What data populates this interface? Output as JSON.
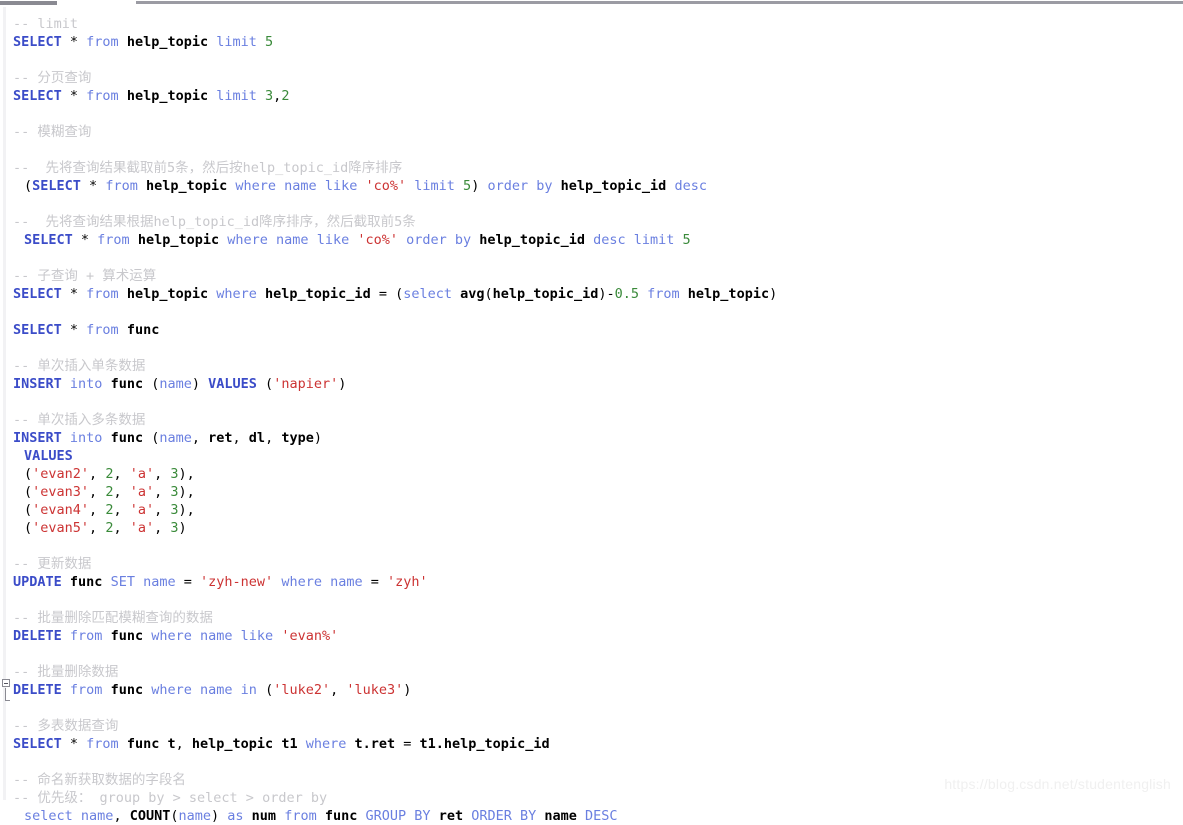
{
  "watermark": "https://blog.csdn.net/studentenglish",
  "colors": {
    "background": "#ffffff",
    "keyword_major": "#3b4cc8",
    "keyword_minor": "#6a7fe0",
    "identifier": "#000000",
    "number": "#3a8a3a",
    "string": "#cc3333",
    "comment": "#c8c8cc",
    "scrollbar": "#8a8a92",
    "watermark": "#f0f0f0"
  },
  "scrollbar": {
    "name": "horizontal-scrollbar",
    "thumb_label": "scroll-thumb",
    "track_label": "scroll-track"
  },
  "fold": {
    "name": "code-fold-collapse",
    "state": "expanded",
    "glyph": "-"
  },
  "lines": [
    {
      "indent": 0,
      "tokens": [
        {
          "t": "cmt",
          "v": "-- limit"
        }
      ]
    },
    {
      "indent": 0,
      "tokens": [
        {
          "t": "kw",
          "v": "SELECT"
        },
        {
          "t": "op",
          "v": " * "
        },
        {
          "t": "kw2",
          "v": "from"
        },
        {
          "t": "op",
          "v": " "
        },
        {
          "t": "ident",
          "v": "help_topic"
        },
        {
          "t": "op",
          "v": " "
        },
        {
          "t": "kw2",
          "v": "limit"
        },
        {
          "t": "op",
          "v": " "
        },
        {
          "t": "num",
          "v": "5"
        }
      ]
    },
    {
      "indent": 0,
      "tokens": []
    },
    {
      "indent": 0,
      "tokens": [
        {
          "t": "cmt",
          "v": "-- 分页查询"
        }
      ]
    },
    {
      "indent": 0,
      "tokens": [
        {
          "t": "kw",
          "v": "SELECT"
        },
        {
          "t": "op",
          "v": " * "
        },
        {
          "t": "kw2",
          "v": "from"
        },
        {
          "t": "op",
          "v": " "
        },
        {
          "t": "ident",
          "v": "help_topic"
        },
        {
          "t": "op",
          "v": " "
        },
        {
          "t": "kw2",
          "v": "limit"
        },
        {
          "t": "op",
          "v": " "
        },
        {
          "t": "num",
          "v": "3"
        },
        {
          "t": "op",
          "v": ","
        },
        {
          "t": "num",
          "v": "2"
        }
      ]
    },
    {
      "indent": 0,
      "tokens": []
    },
    {
      "indent": 0,
      "tokens": [
        {
          "t": "cmt",
          "v": "-- 模糊查询"
        }
      ]
    },
    {
      "indent": 0,
      "tokens": []
    },
    {
      "indent": 0,
      "tokens": [
        {
          "t": "cmt",
          "v": "--  先将查询结果截取前5条，然后按help_topic_id降序排序"
        }
      ]
    },
    {
      "indent": 1,
      "tokens": [
        {
          "t": "op",
          "v": "("
        },
        {
          "t": "kw",
          "v": "SELECT"
        },
        {
          "t": "op",
          "v": " * "
        },
        {
          "t": "kw2",
          "v": "from"
        },
        {
          "t": "op",
          "v": " "
        },
        {
          "t": "ident",
          "v": "help_topic"
        },
        {
          "t": "op",
          "v": " "
        },
        {
          "t": "kw2",
          "v": "where"
        },
        {
          "t": "op",
          "v": " "
        },
        {
          "t": "kw2",
          "v": "name"
        },
        {
          "t": "op",
          "v": " "
        },
        {
          "t": "kw2",
          "v": "like"
        },
        {
          "t": "op",
          "v": " "
        },
        {
          "t": "str",
          "v": "'co%'"
        },
        {
          "t": "op",
          "v": " "
        },
        {
          "t": "kw2",
          "v": "limit"
        },
        {
          "t": "op",
          "v": " "
        },
        {
          "t": "num",
          "v": "5"
        },
        {
          "t": "op",
          "v": ") "
        },
        {
          "t": "kw2",
          "v": "order by"
        },
        {
          "t": "op",
          "v": " "
        },
        {
          "t": "ident",
          "v": "help_topic_id"
        },
        {
          "t": "op",
          "v": " "
        },
        {
          "t": "kw2",
          "v": "desc"
        }
      ]
    },
    {
      "indent": 0,
      "tokens": []
    },
    {
      "indent": 0,
      "tokens": [
        {
          "t": "cmt",
          "v": "--  先将查询结果根据help_topic_id降序排序，然后截取前5条"
        }
      ]
    },
    {
      "indent": 1,
      "tokens": [
        {
          "t": "kw",
          "v": "SELECT"
        },
        {
          "t": "op",
          "v": " * "
        },
        {
          "t": "kw2",
          "v": "from"
        },
        {
          "t": "op",
          "v": " "
        },
        {
          "t": "ident",
          "v": "help_topic"
        },
        {
          "t": "op",
          "v": " "
        },
        {
          "t": "kw2",
          "v": "where"
        },
        {
          "t": "op",
          "v": " "
        },
        {
          "t": "kw2",
          "v": "name"
        },
        {
          "t": "op",
          "v": " "
        },
        {
          "t": "kw2",
          "v": "like"
        },
        {
          "t": "op",
          "v": " "
        },
        {
          "t": "str",
          "v": "'co%'"
        },
        {
          "t": "op",
          "v": " "
        },
        {
          "t": "kw2",
          "v": "order by"
        },
        {
          "t": "op",
          "v": " "
        },
        {
          "t": "ident",
          "v": "help_topic_id"
        },
        {
          "t": "op",
          "v": " "
        },
        {
          "t": "kw2",
          "v": "desc"
        },
        {
          "t": "op",
          "v": " "
        },
        {
          "t": "kw2",
          "v": "limit"
        },
        {
          "t": "op",
          "v": " "
        },
        {
          "t": "num",
          "v": "5"
        }
      ]
    },
    {
      "indent": 0,
      "tokens": []
    },
    {
      "indent": 0,
      "tokens": [
        {
          "t": "cmt",
          "v": "-- 子查询 + 算术运算"
        }
      ]
    },
    {
      "indent": 0,
      "tokens": [
        {
          "t": "kw",
          "v": "SELECT"
        },
        {
          "t": "op",
          "v": " * "
        },
        {
          "t": "kw2",
          "v": "from"
        },
        {
          "t": "op",
          "v": " "
        },
        {
          "t": "ident",
          "v": "help_topic"
        },
        {
          "t": "op",
          "v": " "
        },
        {
          "t": "kw2",
          "v": "where"
        },
        {
          "t": "op",
          "v": " "
        },
        {
          "t": "ident",
          "v": "help_topic_id"
        },
        {
          "t": "op",
          "v": " = ("
        },
        {
          "t": "kw2",
          "v": "select"
        },
        {
          "t": "op",
          "v": " "
        },
        {
          "t": "fn",
          "v": "avg"
        },
        {
          "t": "op",
          "v": "("
        },
        {
          "t": "ident",
          "v": "help_topic_id"
        },
        {
          "t": "op",
          "v": ")-"
        },
        {
          "t": "num",
          "v": "0.5"
        },
        {
          "t": "op",
          "v": " "
        },
        {
          "t": "kw2",
          "v": "from"
        },
        {
          "t": "op",
          "v": " "
        },
        {
          "t": "ident",
          "v": "help_topic"
        },
        {
          "t": "op",
          "v": ")"
        }
      ]
    },
    {
      "indent": 0,
      "tokens": []
    },
    {
      "indent": 0,
      "tokens": [
        {
          "t": "kw",
          "v": "SELECT"
        },
        {
          "t": "op",
          "v": " * "
        },
        {
          "t": "kw2",
          "v": "from"
        },
        {
          "t": "op",
          "v": " "
        },
        {
          "t": "ident",
          "v": "func"
        }
      ]
    },
    {
      "indent": 0,
      "tokens": []
    },
    {
      "indent": 0,
      "tokens": [
        {
          "t": "cmt",
          "v": "-- 单次插入单条数据"
        }
      ]
    },
    {
      "indent": 0,
      "tokens": [
        {
          "t": "kw",
          "v": "INSERT"
        },
        {
          "t": "op",
          "v": " "
        },
        {
          "t": "kw2",
          "v": "into"
        },
        {
          "t": "op",
          "v": " "
        },
        {
          "t": "ident",
          "v": "func"
        },
        {
          "t": "op",
          "v": " ("
        },
        {
          "t": "kw2",
          "v": "name"
        },
        {
          "t": "op",
          "v": ") "
        },
        {
          "t": "kw",
          "v": "VALUES"
        },
        {
          "t": "op",
          "v": " ("
        },
        {
          "t": "str",
          "v": "'napier'"
        },
        {
          "t": "op",
          "v": ")"
        }
      ]
    },
    {
      "indent": 0,
      "tokens": []
    },
    {
      "indent": 0,
      "tokens": [
        {
          "t": "cmt",
          "v": "-- 单次插入多条数据"
        }
      ]
    },
    {
      "indent": 0,
      "tokens": [
        {
          "t": "kw",
          "v": "INSERT"
        },
        {
          "t": "op",
          "v": " "
        },
        {
          "t": "kw2",
          "v": "into"
        },
        {
          "t": "op",
          "v": " "
        },
        {
          "t": "ident",
          "v": "func"
        },
        {
          "t": "op",
          "v": " ("
        },
        {
          "t": "kw2",
          "v": "name"
        },
        {
          "t": "op",
          "v": ", "
        },
        {
          "t": "ident",
          "v": "ret"
        },
        {
          "t": "op",
          "v": ", "
        },
        {
          "t": "ident",
          "v": "dl"
        },
        {
          "t": "op",
          "v": ", "
        },
        {
          "t": "ident",
          "v": "type"
        },
        {
          "t": "op",
          "v": ")"
        }
      ]
    },
    {
      "indent": 1,
      "tokens": [
        {
          "t": "kw",
          "v": "VALUES"
        }
      ]
    },
    {
      "indent": 1,
      "tokens": [
        {
          "t": "op",
          "v": "("
        },
        {
          "t": "str",
          "v": "'evan2'"
        },
        {
          "t": "op",
          "v": ", "
        },
        {
          "t": "num",
          "v": "2"
        },
        {
          "t": "op",
          "v": ", "
        },
        {
          "t": "str",
          "v": "'a'"
        },
        {
          "t": "op",
          "v": ", "
        },
        {
          "t": "num",
          "v": "3"
        },
        {
          "t": "op",
          "v": "),"
        }
      ]
    },
    {
      "indent": 1,
      "tokens": [
        {
          "t": "op",
          "v": "("
        },
        {
          "t": "str",
          "v": "'evan3'"
        },
        {
          "t": "op",
          "v": ", "
        },
        {
          "t": "num",
          "v": "2"
        },
        {
          "t": "op",
          "v": ", "
        },
        {
          "t": "str",
          "v": "'a'"
        },
        {
          "t": "op",
          "v": ", "
        },
        {
          "t": "num",
          "v": "3"
        },
        {
          "t": "op",
          "v": "),"
        }
      ]
    },
    {
      "indent": 1,
      "tokens": [
        {
          "t": "op",
          "v": "("
        },
        {
          "t": "str",
          "v": "'evan4'"
        },
        {
          "t": "op",
          "v": ", "
        },
        {
          "t": "num",
          "v": "2"
        },
        {
          "t": "op",
          "v": ", "
        },
        {
          "t": "str",
          "v": "'a'"
        },
        {
          "t": "op",
          "v": ", "
        },
        {
          "t": "num",
          "v": "3"
        },
        {
          "t": "op",
          "v": "),"
        }
      ]
    },
    {
      "indent": 1,
      "tokens": [
        {
          "t": "op",
          "v": "("
        },
        {
          "t": "str",
          "v": "'evan5'"
        },
        {
          "t": "op",
          "v": ", "
        },
        {
          "t": "num",
          "v": "2"
        },
        {
          "t": "op",
          "v": ", "
        },
        {
          "t": "str",
          "v": "'a'"
        },
        {
          "t": "op",
          "v": ", "
        },
        {
          "t": "num",
          "v": "3"
        },
        {
          "t": "op",
          "v": ")"
        }
      ]
    },
    {
      "indent": 0,
      "tokens": []
    },
    {
      "indent": 0,
      "tokens": [
        {
          "t": "cmt",
          "v": "-- 更新数据"
        }
      ]
    },
    {
      "indent": 0,
      "tokens": [
        {
          "t": "kw",
          "v": "UPDATE"
        },
        {
          "t": "op",
          "v": " "
        },
        {
          "t": "ident",
          "v": "func"
        },
        {
          "t": "op",
          "v": " "
        },
        {
          "t": "kw2",
          "v": "SET"
        },
        {
          "t": "op",
          "v": " "
        },
        {
          "t": "kw2",
          "v": "name"
        },
        {
          "t": "op",
          "v": " = "
        },
        {
          "t": "str",
          "v": "'zyh-new'"
        },
        {
          "t": "op",
          "v": " "
        },
        {
          "t": "kw2",
          "v": "where"
        },
        {
          "t": "op",
          "v": " "
        },
        {
          "t": "kw2",
          "v": "name"
        },
        {
          "t": "op",
          "v": " = "
        },
        {
          "t": "str",
          "v": "'zyh'"
        }
      ]
    },
    {
      "indent": 0,
      "tokens": []
    },
    {
      "indent": 0,
      "tokens": [
        {
          "t": "cmt",
          "v": "-- 批量删除匹配模糊查询的数据"
        }
      ]
    },
    {
      "indent": 0,
      "tokens": [
        {
          "t": "kw",
          "v": "DELETE"
        },
        {
          "t": "op",
          "v": " "
        },
        {
          "t": "kw2",
          "v": "from"
        },
        {
          "t": "op",
          "v": " "
        },
        {
          "t": "ident",
          "v": "func"
        },
        {
          "t": "op",
          "v": " "
        },
        {
          "t": "kw2",
          "v": "where"
        },
        {
          "t": "op",
          "v": " "
        },
        {
          "t": "kw2",
          "v": "name"
        },
        {
          "t": "op",
          "v": " "
        },
        {
          "t": "kw2",
          "v": "like"
        },
        {
          "t": "op",
          "v": " "
        },
        {
          "t": "str",
          "v": "'evan%'"
        }
      ]
    },
    {
      "indent": 0,
      "tokens": []
    },
    {
      "indent": 0,
      "tokens": [
        {
          "t": "cmt",
          "v": "-- 批量删除数据"
        }
      ]
    },
    {
      "indent": 0,
      "tokens": [
        {
          "t": "kw",
          "v": "DELETE"
        },
        {
          "t": "op",
          "v": " "
        },
        {
          "t": "kw2",
          "v": "from"
        },
        {
          "t": "op",
          "v": " "
        },
        {
          "t": "ident",
          "v": "func"
        },
        {
          "t": "op",
          "v": " "
        },
        {
          "t": "kw2",
          "v": "where"
        },
        {
          "t": "op",
          "v": " "
        },
        {
          "t": "kw2",
          "v": "name"
        },
        {
          "t": "op",
          "v": " "
        },
        {
          "t": "kw2",
          "v": "in"
        },
        {
          "t": "op",
          "v": " ("
        },
        {
          "t": "str",
          "v": "'luke2'"
        },
        {
          "t": "op",
          "v": ", "
        },
        {
          "t": "str",
          "v": "'luke3'"
        },
        {
          "t": "op",
          "v": ")"
        }
      ]
    },
    {
      "indent": 0,
      "tokens": []
    },
    {
      "indent": 0,
      "tokens": [
        {
          "t": "cmt",
          "v": "-- 多表数据查询"
        }
      ]
    },
    {
      "indent": 0,
      "tokens": [
        {
          "t": "kw",
          "v": "SELECT"
        },
        {
          "t": "op",
          "v": " * "
        },
        {
          "t": "kw2",
          "v": "from"
        },
        {
          "t": "op",
          "v": " "
        },
        {
          "t": "ident",
          "v": "func"
        },
        {
          "t": "op",
          "v": " "
        },
        {
          "t": "ident",
          "v": "t"
        },
        {
          "t": "op",
          "v": ", "
        },
        {
          "t": "ident",
          "v": "help_topic"
        },
        {
          "t": "op",
          "v": " "
        },
        {
          "t": "ident",
          "v": "t1"
        },
        {
          "t": "op",
          "v": " "
        },
        {
          "t": "kw2",
          "v": "where"
        },
        {
          "t": "op",
          "v": " "
        },
        {
          "t": "ident",
          "v": "t.ret"
        },
        {
          "t": "op",
          "v": " = "
        },
        {
          "t": "ident",
          "v": "t1.help_topic_id"
        }
      ]
    },
    {
      "indent": 0,
      "tokens": []
    },
    {
      "indent": 0,
      "tokens": [
        {
          "t": "cmt",
          "v": "-- 命名新获取数据的字段名"
        }
      ]
    },
    {
      "indent": 0,
      "tokens": [
        {
          "t": "cmt",
          "v": "-- 优先级： group by > select > order by"
        }
      ]
    },
    {
      "indent": 1,
      "tokens": [
        {
          "t": "kw2",
          "v": "select"
        },
        {
          "t": "op",
          "v": " "
        },
        {
          "t": "kw2",
          "v": "name"
        },
        {
          "t": "op",
          "v": ", "
        },
        {
          "t": "fn",
          "v": "COUNT"
        },
        {
          "t": "op",
          "v": "("
        },
        {
          "t": "kw2",
          "v": "name"
        },
        {
          "t": "op",
          "v": ") "
        },
        {
          "t": "kw2",
          "v": "as"
        },
        {
          "t": "op",
          "v": " "
        },
        {
          "t": "ident",
          "v": "num"
        },
        {
          "t": "op",
          "v": " "
        },
        {
          "t": "kw2",
          "v": "from"
        },
        {
          "t": "op",
          "v": " "
        },
        {
          "t": "ident",
          "v": "func"
        },
        {
          "t": "op",
          "v": " "
        },
        {
          "t": "kw2",
          "v": "GROUP BY"
        },
        {
          "t": "op",
          "v": " "
        },
        {
          "t": "ident",
          "v": "ret"
        },
        {
          "t": "op",
          "v": " "
        },
        {
          "t": "kw2",
          "v": "ORDER BY"
        },
        {
          "t": "op",
          "v": " "
        },
        {
          "t": "ident",
          "v": "name"
        },
        {
          "t": "op",
          "v": " "
        },
        {
          "t": "kw2",
          "v": "DESC"
        }
      ]
    }
  ]
}
